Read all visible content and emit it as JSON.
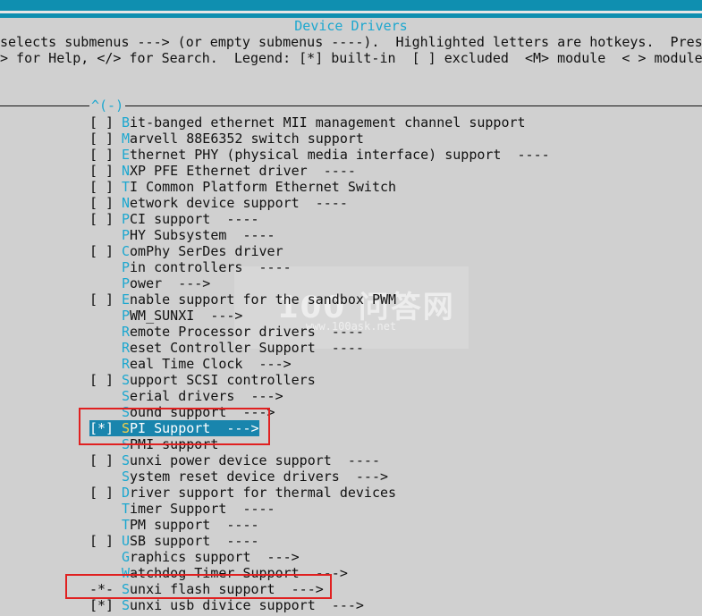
{
  "window": {
    "title": "Device Drivers"
  },
  "help": {
    "line1": "selects submenus ---> (or empty submenus ----).  Highlighted letters are hotkeys.  Press",
    "line2": "> for Help, </> for Search.  Legend: [*] built-in  [ ] excluded  <M> module  < > module"
  },
  "scroll_indicator": "^(-)",
  "watermark": {
    "text1": "100 问答网",
    "text2": "www.100ask.net"
  },
  "colors": {
    "accent": "#1ca7cf",
    "topbar": "#0f8fb0",
    "selection": "#1985ad",
    "hotkey_selected": "#f2d04a",
    "annotation": "#e02020"
  },
  "items": [
    {
      "mark": "[ ]",
      "hot": "B",
      "rest": "it-banged ethernet MII management channel support"
    },
    {
      "mark": "[ ]",
      "hot": "M",
      "rest": "arvell 88E6352 switch support"
    },
    {
      "mark": "[ ]",
      "hot": "E",
      "rest": "thernet PHY (physical media interface) support  ----"
    },
    {
      "mark": "[ ]",
      "hot": "N",
      "rest": "XP PFE Ethernet driver  ----"
    },
    {
      "mark": "[ ]",
      "hot": "T",
      "rest": "I Common Platform Ethernet Switch"
    },
    {
      "mark": "[ ]",
      "hot": "N",
      "rest": "etwork device support  ----"
    },
    {
      "mark": "[ ]",
      "hot": "P",
      "rest": "CI support  ----"
    },
    {
      "mark": "",
      "hot": "P",
      "rest": "HY Subsystem  ----"
    },
    {
      "mark": "[ ]",
      "hot": "C",
      "rest": "omPhy SerDes driver"
    },
    {
      "mark": "",
      "hot": "P",
      "rest": "in controllers  ----"
    },
    {
      "mark": "",
      "hot": "P",
      "rest": "ower  --->"
    },
    {
      "mark": "[ ]",
      "hot": "E",
      "rest": "nable support for the sandbox PWM"
    },
    {
      "mark": "",
      "hot": "P",
      "rest": "WM_SUNXI  --->"
    },
    {
      "mark": "",
      "hot": "R",
      "rest": "emote Processor drivers  ----"
    },
    {
      "mark": "",
      "hot": "R",
      "rest": "eset Controller Support  ----"
    },
    {
      "mark": "",
      "hot": "R",
      "rest": "eal Time Clock  --->"
    },
    {
      "mark": "[ ]",
      "hot": "S",
      "rest": "upport SCSI controllers"
    },
    {
      "mark": "",
      "hot": "S",
      "rest": "erial drivers  --->"
    },
    {
      "mark": "",
      "hot": "S",
      "rest": "ound support  --->"
    },
    {
      "mark": "[*]",
      "hot": "S",
      "rest": "PI Support  --->",
      "selected": true
    },
    {
      "mark": "",
      "hot": "S",
      "rest": "PMI support"
    },
    {
      "mark": "[ ]",
      "hot": "S",
      "rest": "unxi power device support  ----"
    },
    {
      "mark": "",
      "hot": "S",
      "rest": "ystem reset device drivers  --->"
    },
    {
      "mark": "[ ]",
      "hot": "D",
      "rest": "river support for thermal devices"
    },
    {
      "mark": "",
      "hot": "T",
      "rest": "imer Support  ----"
    },
    {
      "mark": "",
      "hot": "T",
      "rest": "PM support  ----"
    },
    {
      "mark": "[ ]",
      "hot": "U",
      "rest": "SB support  ----"
    },
    {
      "mark": "",
      "hot": "G",
      "rest": "raphics support  --->"
    },
    {
      "mark": "",
      "hot": "W",
      "rest": "atchdog Timer Support  --->"
    },
    {
      "mark": "-*-",
      "hot": "S",
      "rest": "unxi flash support  --->"
    },
    {
      "mark": "[*]",
      "hot": "S",
      "rest": "unxi usb divice support  --->"
    }
  ]
}
